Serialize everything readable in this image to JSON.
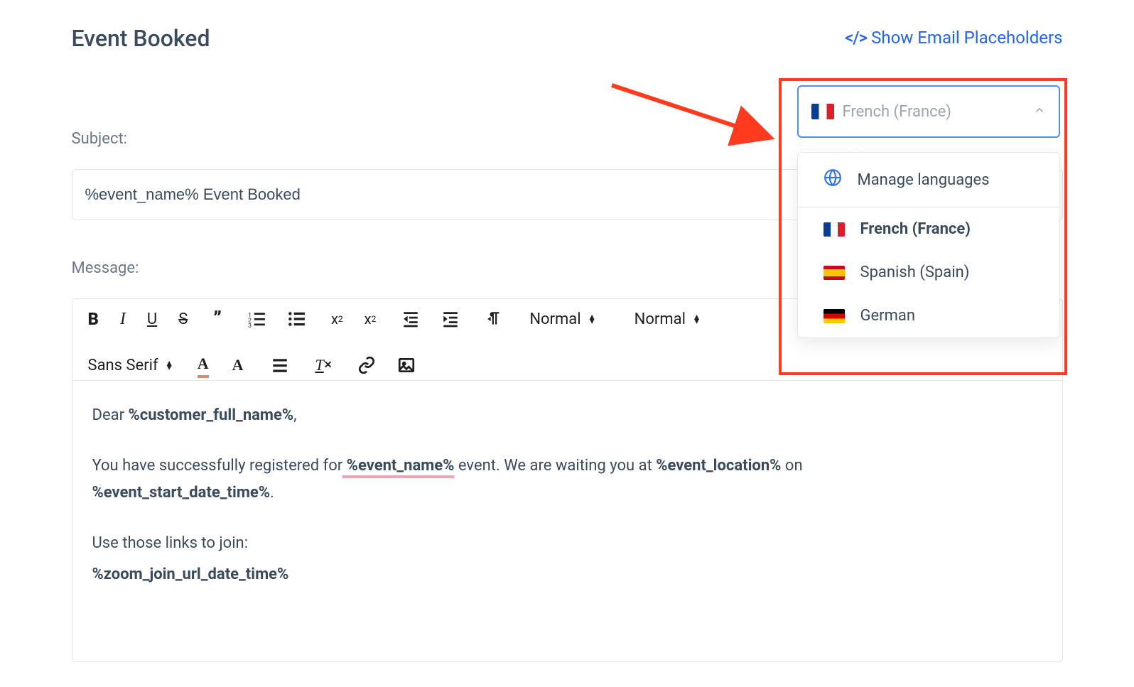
{
  "header": {
    "title": "Event Booked",
    "show_placeholders_label": "Show Email Placeholders"
  },
  "language": {
    "selected_placeholder": "French (France)",
    "manage_label": "Manage languages",
    "options": [
      {
        "label": "French (France)",
        "flag": "fr",
        "selected": true
      },
      {
        "label": "Spanish (Spain)",
        "flag": "es",
        "selected": false
      },
      {
        "label": "German",
        "flag": "de",
        "selected": false
      }
    ]
  },
  "subject": {
    "label": "Subject:",
    "value": "%event_name% Event Booked"
  },
  "message": {
    "label": "Message:",
    "toolbar": {
      "heading_select": "Normal",
      "size_select": "Normal",
      "font_select": "Sans Serif"
    },
    "body": {
      "greeting_pre": "Dear ",
      "greeting_ph": "%customer_full_name%",
      "p2_a": "You have successfully registered for",
      "p2_event_ph": " %event_name%",
      "p2_b": " event. We are waiting you at ",
      "p2_loc_ph": "%event_location%",
      "p2_c": " on ",
      "p2_start_ph": "%event_start_date_time%",
      "p3": "Use those links to join:",
      "p4_ph": "%zoom_join_url_date_time%"
    }
  }
}
